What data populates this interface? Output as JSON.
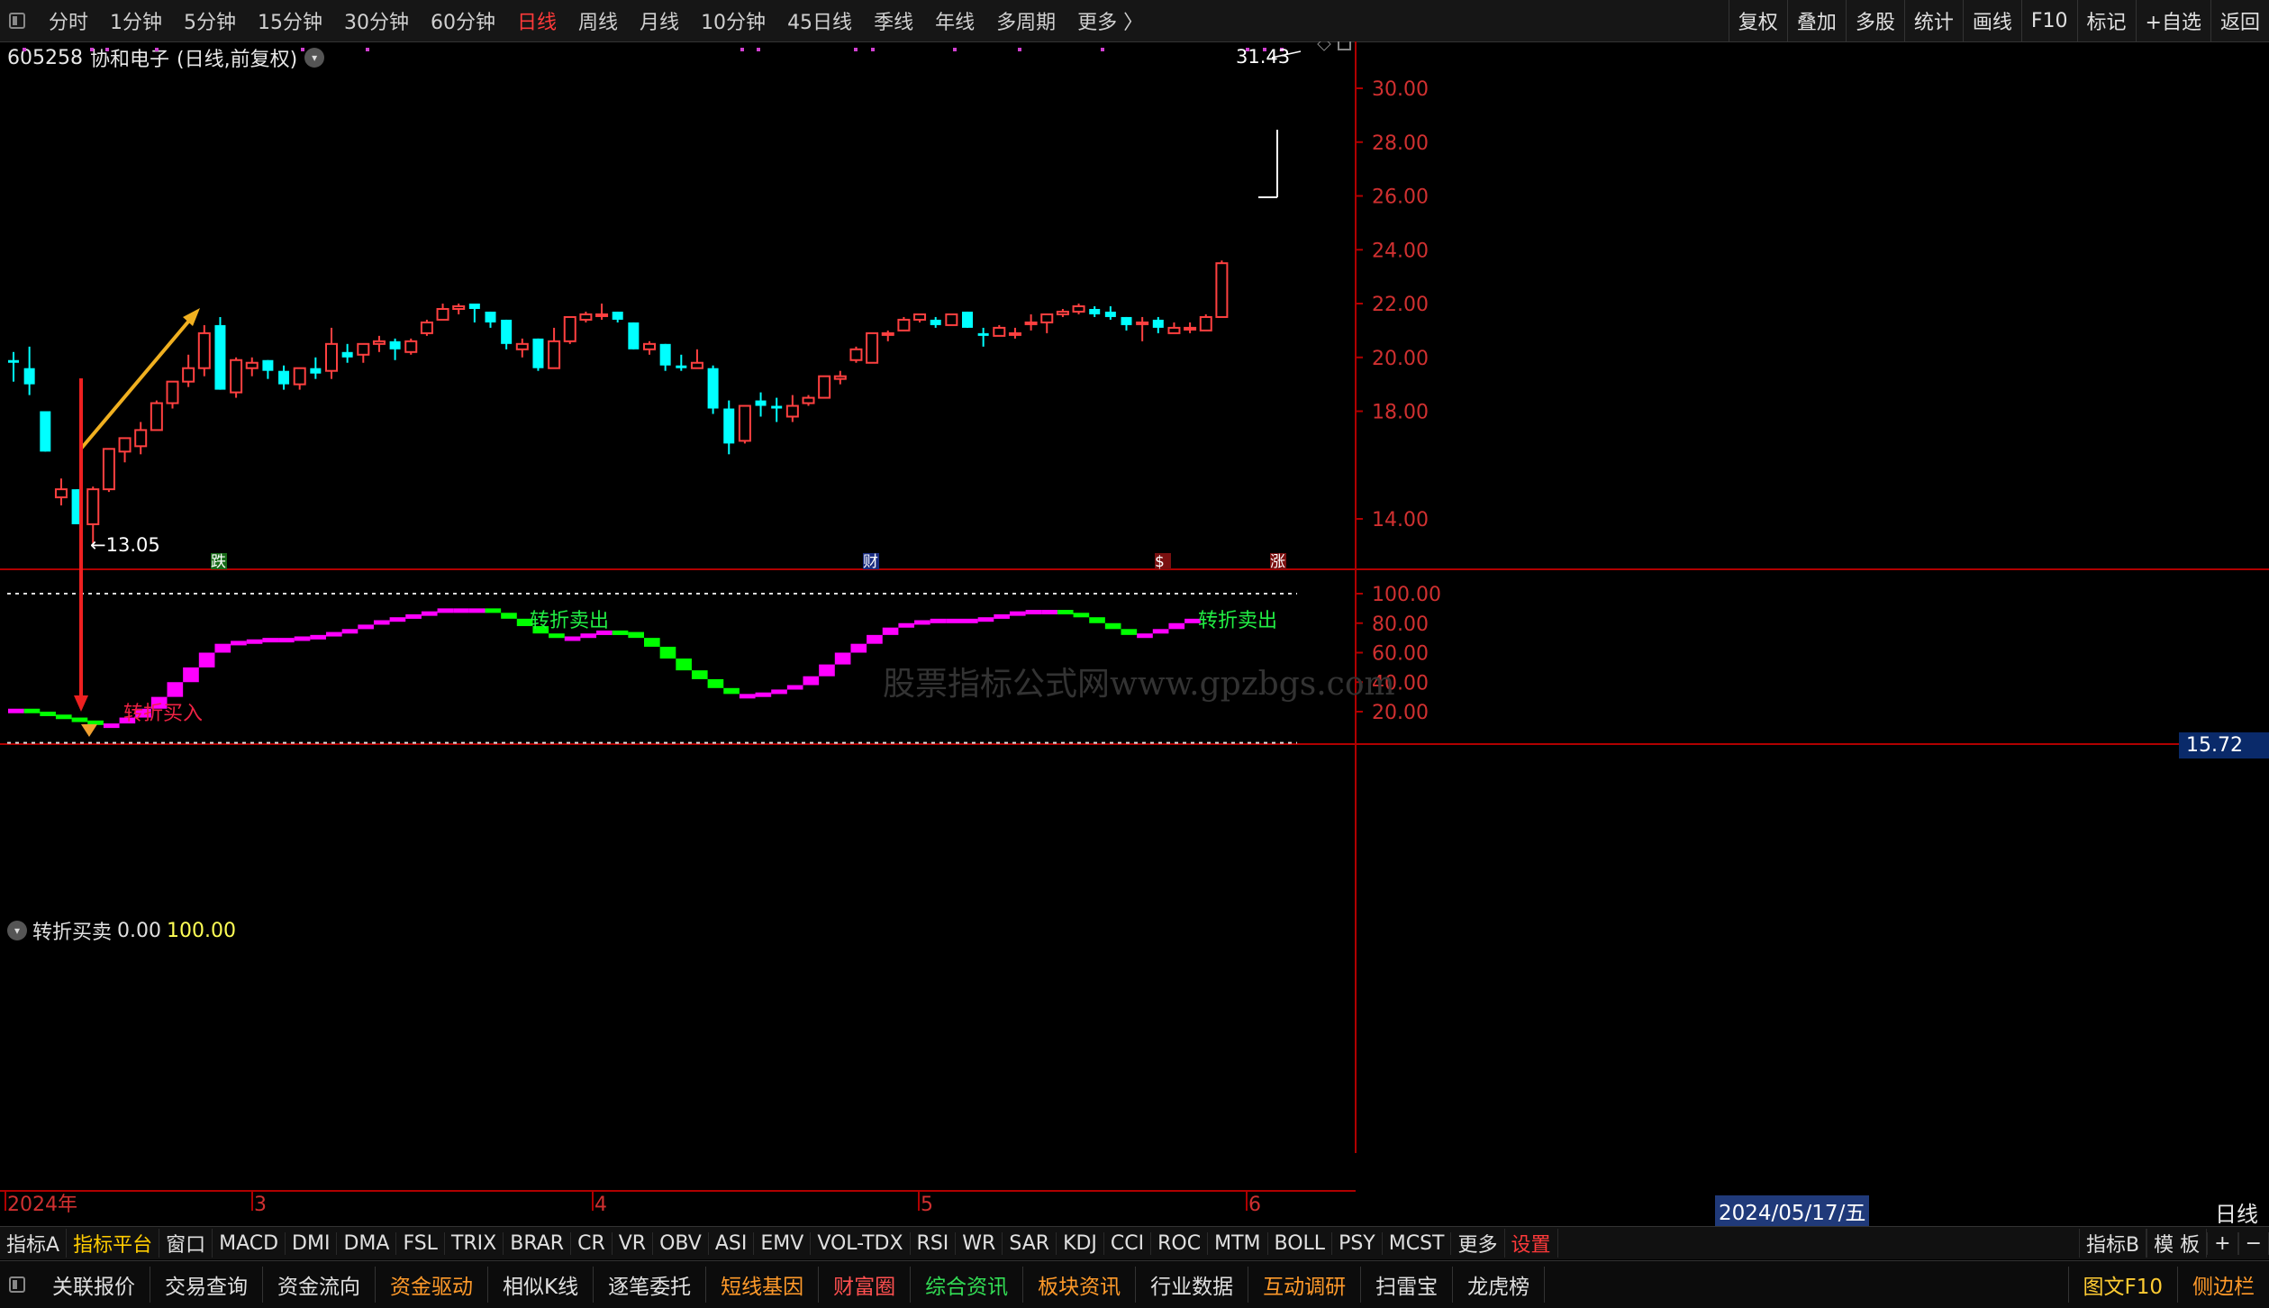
{
  "top_tabs": [
    "分时",
    "1分钟",
    "5分钟",
    "15分钟",
    "30分钟",
    "60分钟",
    "日线",
    "周线",
    "月线",
    "10分钟",
    "45日线",
    "季线",
    "年线",
    "多周期",
    "更多 〉"
  ],
  "active_tab": "日线",
  "top_right": [
    "复权",
    "叠加",
    "多股",
    "统计",
    "画线",
    "F10",
    "标记",
    "+自选",
    "返回"
  ],
  "stock": {
    "code": "605258",
    "name": "协和电子",
    "mode": "(日线,前复权)"
  },
  "price_axis": {
    "labels": [
      "30.00",
      "28.00",
      "26.00",
      "24.00",
      "22.00",
      "20.00",
      "18.00",
      "14.00"
    ],
    "current_price": "15.72"
  },
  "annotations": {
    "high_label": "31.43",
    "low_label": "←13.05",
    "watermark": "股票指标公式网www.gpzbgs.com"
  },
  "event_markers": {
    "die": "跌",
    "cai": "财",
    "s": "$",
    "zhang": "涨"
  },
  "indicator": {
    "name": "转折买卖",
    "value_a": "0.00",
    "value_b": "100.00",
    "axis": [
      "100.00",
      "80.00",
      "60.00",
      "40.00",
      "20.00"
    ],
    "sell_label": "转折卖出",
    "buy_label": "转折买入"
  },
  "time_axis": {
    "labels": [
      "2024年",
      "3",
      "4",
      "5",
      "6"
    ],
    "cursor_date": "2024/05/17/五",
    "period": "日线"
  },
  "colors": {
    "up": "#ff4040",
    "down": "#00ffff",
    "ind_up": "#ff00ff",
    "ind_down": "#00ff00",
    "panel_border": "#b00000"
  },
  "chart_data": {
    "type": "candlestick",
    "note_price_range": [
      13.05,
      31.43
    ],
    "candles": [
      {
        "o": 19.9,
        "h": 20.2,
        "l": 19.1,
        "c": 19.8
      },
      {
        "o": 19.6,
        "h": 20.4,
        "l": 18.6,
        "c": 19.0
      },
      {
        "o": 18.0,
        "h": 18.0,
        "l": 16.5,
        "c": 16.5
      },
      {
        "o": 14.8,
        "h": 15.5,
        "l": 14.5,
        "c": 15.1
      },
      {
        "o": 15.1,
        "h": 15.1,
        "l": 13.8,
        "c": 13.8
      },
      {
        "o": 13.8,
        "h": 15.2,
        "l": 13.1,
        "c": 15.1
      },
      {
        "o": 15.1,
        "h": 16.6,
        "l": 15.0,
        "c": 16.6
      },
      {
        "o": 16.5,
        "h": 17.0,
        "l": 16.1,
        "c": 17.0
      },
      {
        "o": 16.7,
        "h": 17.6,
        "l": 16.4,
        "c": 17.3
      },
      {
        "o": 17.3,
        "h": 18.4,
        "l": 17.3,
        "c": 18.3
      },
      {
        "o": 18.3,
        "h": 19.1,
        "l": 18.1,
        "c": 19.1
      },
      {
        "o": 19.1,
        "h": 20.1,
        "l": 18.9,
        "c": 19.6
      },
      {
        "o": 19.6,
        "h": 21.2,
        "l": 19.3,
        "c": 20.9
      },
      {
        "o": 21.2,
        "h": 21.5,
        "l": 18.8,
        "c": 18.8
      },
      {
        "o": 18.7,
        "h": 20.0,
        "l": 18.5,
        "c": 19.9
      },
      {
        "o": 19.6,
        "h": 20.0,
        "l": 19.3,
        "c": 19.8
      },
      {
        "o": 19.9,
        "h": 19.9,
        "l": 19.2,
        "c": 19.5
      },
      {
        "o": 19.5,
        "h": 19.7,
        "l": 18.8,
        "c": 19.0
      },
      {
        "o": 19.0,
        "h": 19.6,
        "l": 18.8,
        "c": 19.6
      },
      {
        "o": 19.6,
        "h": 20.0,
        "l": 19.2,
        "c": 19.4
      },
      {
        "o": 19.5,
        "h": 21.1,
        "l": 19.2,
        "c": 20.5
      },
      {
        "o": 20.2,
        "h": 20.5,
        "l": 19.8,
        "c": 20.0
      },
      {
        "o": 20.1,
        "h": 20.5,
        "l": 19.8,
        "c": 20.5
      },
      {
        "o": 20.5,
        "h": 20.8,
        "l": 20.2,
        "c": 20.6
      },
      {
        "o": 20.6,
        "h": 20.7,
        "l": 19.9,
        "c": 20.3
      },
      {
        "o": 20.2,
        "h": 20.7,
        "l": 20.1,
        "c": 20.6
      },
      {
        "o": 20.9,
        "h": 21.4,
        "l": 20.8,
        "c": 21.3
      },
      {
        "o": 21.4,
        "h": 22.0,
        "l": 21.4,
        "c": 21.8
      },
      {
        "o": 21.8,
        "h": 22.0,
        "l": 21.6,
        "c": 21.9
      },
      {
        "o": 22.0,
        "h": 22.0,
        "l": 21.3,
        "c": 21.8
      },
      {
        "o": 21.7,
        "h": 21.7,
        "l": 21.1,
        "c": 21.3
      },
      {
        "o": 21.4,
        "h": 21.4,
        "l": 20.3,
        "c": 20.5
      },
      {
        "o": 20.3,
        "h": 20.7,
        "l": 20.0,
        "c": 20.5
      },
      {
        "o": 20.7,
        "h": 20.7,
        "l": 19.5,
        "c": 19.6
      },
      {
        "o": 19.6,
        "h": 21.1,
        "l": 19.6,
        "c": 20.6
      },
      {
        "o": 20.6,
        "h": 21.5,
        "l": 20.5,
        "c": 21.5
      },
      {
        "o": 21.4,
        "h": 21.7,
        "l": 21.3,
        "c": 21.6
      },
      {
        "o": 21.6,
        "h": 22.0,
        "l": 21.4,
        "c": 21.6
      },
      {
        "o": 21.7,
        "h": 21.7,
        "l": 21.3,
        "c": 21.4
      },
      {
        "o": 21.3,
        "h": 21.3,
        "l": 20.3,
        "c": 20.3
      },
      {
        "o": 20.3,
        "h": 20.6,
        "l": 20.1,
        "c": 20.5
      },
      {
        "o": 20.5,
        "h": 20.5,
        "l": 19.5,
        "c": 19.7
      },
      {
        "o": 19.7,
        "h": 20.1,
        "l": 19.5,
        "c": 19.6
      },
      {
        "o": 19.6,
        "h": 20.3,
        "l": 19.6,
        "c": 19.8
      },
      {
        "o": 19.6,
        "h": 19.7,
        "l": 17.9,
        "c": 18.1
      },
      {
        "o": 18.1,
        "h": 18.4,
        "l": 16.4,
        "c": 16.8
      },
      {
        "o": 16.9,
        "h": 18.2,
        "l": 16.8,
        "c": 18.2
      },
      {
        "o": 18.4,
        "h": 18.7,
        "l": 17.8,
        "c": 18.2
      },
      {
        "o": 18.2,
        "h": 18.5,
        "l": 17.6,
        "c": 18.1
      },
      {
        "o": 17.8,
        "h": 18.6,
        "l": 17.6,
        "c": 18.2
      },
      {
        "o": 18.3,
        "h": 18.6,
        "l": 18.2,
        "c": 18.5
      },
      {
        "o": 18.5,
        "h": 19.3,
        "l": 18.5,
        "c": 19.3
      },
      {
        "o": 19.2,
        "h": 19.5,
        "l": 19.0,
        "c": 19.3
      },
      {
        "o": 19.9,
        "h": 20.4,
        "l": 19.8,
        "c": 20.3
      },
      {
        "o": 19.8,
        "h": 20.9,
        "l": 19.8,
        "c": 20.9
      },
      {
        "o": 20.9,
        "h": 21.0,
        "l": 20.6,
        "c": 20.9
      },
      {
        "o": 21.0,
        "h": 21.5,
        "l": 21.0,
        "c": 21.4
      },
      {
        "o": 21.4,
        "h": 21.6,
        "l": 21.3,
        "c": 21.6
      },
      {
        "o": 21.4,
        "h": 21.5,
        "l": 21.1,
        "c": 21.2
      },
      {
        "o": 21.2,
        "h": 21.6,
        "l": 21.2,
        "c": 21.6
      },
      {
        "o": 21.7,
        "h": 21.7,
        "l": 21.1,
        "c": 21.1
      },
      {
        "o": 20.9,
        "h": 21.1,
        "l": 20.4,
        "c": 20.8
      },
      {
        "o": 20.8,
        "h": 21.2,
        "l": 20.8,
        "c": 21.1
      },
      {
        "o": 20.9,
        "h": 21.1,
        "l": 20.7,
        "c": 20.9
      },
      {
        "o": 21.3,
        "h": 21.6,
        "l": 21.0,
        "c": 21.3
      },
      {
        "o": 21.3,
        "h": 21.6,
        "l": 20.9,
        "c": 21.6
      },
      {
        "o": 21.6,
        "h": 21.8,
        "l": 21.5,
        "c": 21.7
      },
      {
        "o": 21.7,
        "h": 22.0,
        "l": 21.6,
        "c": 21.9
      },
      {
        "o": 21.8,
        "h": 21.9,
        "l": 21.5,
        "c": 21.6
      },
      {
        "o": 21.7,
        "h": 21.9,
        "l": 21.4,
        "c": 21.5
      },
      {
        "o": 21.5,
        "h": 21.5,
        "l": 21.0,
        "c": 21.2
      },
      {
        "o": 21.3,
        "h": 21.5,
        "l": 20.6,
        "c": 21.3
      },
      {
        "o": 21.4,
        "h": 21.5,
        "l": 20.9,
        "c": 21.1
      },
      {
        "o": 20.9,
        "h": 21.3,
        "l": 20.9,
        "c": 21.1
      },
      {
        "o": 21.1,
        "h": 21.3,
        "l": 20.9,
        "c": 21.1
      },
      {
        "o": 21.0,
        "h": 21.6,
        "l": 21.0,
        "c": 21.5
      },
      {
        "o": 21.5,
        "h": 23.6,
        "l": 21.5,
        "c": 23.5
      }
    ],
    "indicator_values": [
      22,
      20,
      18,
      16,
      14,
      12,
      12,
      16,
      22,
      30,
      40,
      50,
      60,
      66,
      68,
      69,
      70,
      70,
      71,
      72,
      74,
      76,
      79,
      82,
      84,
      86,
      88,
      90,
      90,
      90,
      87,
      83,
      78,
      73,
      70,
      71,
      73,
      75,
      74,
      70,
      64,
      56,
      48,
      42,
      36,
      32,
      32,
      33,
      35,
      38,
      44,
      52,
      60,
      66,
      72,
      77,
      80,
      82,
      83,
      83,
      83,
      84,
      86,
      88,
      89,
      89,
      87,
      84,
      80,
      76,
      72,
      73,
      76,
      80,
      83
    ]
  }
}
